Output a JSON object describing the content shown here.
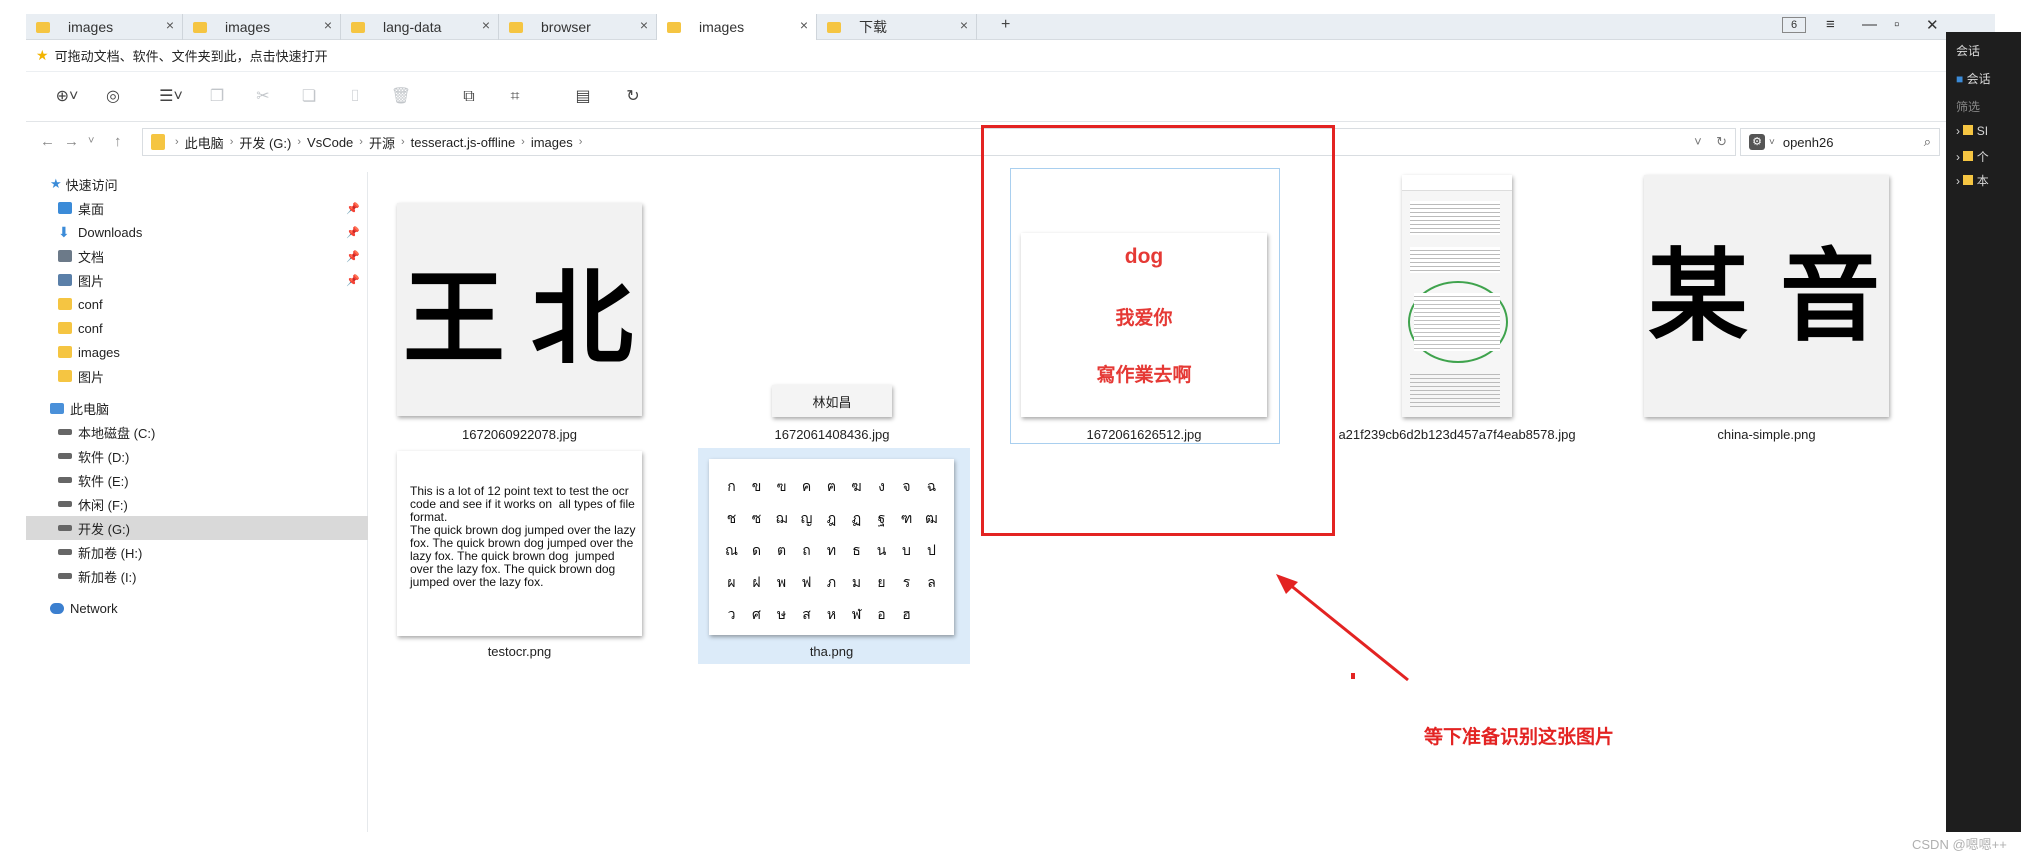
{
  "tabs": [
    {
      "label": "images",
      "active": false
    },
    {
      "label": "images",
      "active": false
    },
    {
      "label": "lang-data",
      "active": false
    },
    {
      "label": "browser",
      "active": false
    },
    {
      "label": "images",
      "active": true
    },
    {
      "label": "下载",
      "active": false
    }
  ],
  "window": {
    "tab_count_badge": "6"
  },
  "quick_hint": "可拖动文档、软件、文件夹到此，点击快速打开",
  "breadcrumb": [
    "此电脑",
    "开发 (G:)",
    "VsCode",
    "开源",
    "tesseract.js-offline",
    "images"
  ],
  "search": {
    "value": "openh26"
  },
  "sidebar": {
    "quick_access": "快速访问",
    "items": [
      "桌面",
      "Downloads",
      "文档",
      "图片",
      "conf",
      "conf",
      "images",
      "图片"
    ],
    "this_pc": "此电脑",
    "drives": [
      "本地磁盘 (C:)",
      "软件 (D:)",
      "软件 (E:)",
      "休闲 (F:)",
      "开发 (G:)",
      "新加卷 (H:)",
      "新加卷 (I:)"
    ],
    "network": "Network"
  },
  "files": {
    "f1": {
      "name": "1672060922078.jpg",
      "chars": [
        "王",
        "北"
      ]
    },
    "f2": {
      "name": "1672061408436.jpg",
      "text": "林如昌"
    },
    "f3": {
      "name": "1672061626512.jpg",
      "lines": [
        "dog",
        "我爱你",
        "寫作業去啊"
      ]
    },
    "f4": {
      "name": "a21f239cb6d2b123d457a7f4eab8578.jpg"
    },
    "f5": {
      "name": "china-simple.png",
      "chars": [
        "某",
        "音"
      ]
    },
    "f6": {
      "name": "testocr.png",
      "text": "This is a lot of 12 point text to test the ocr code and see if it works on  all types of file format.\nThe quick brown dog jumped over the lazy fox. The quick brown dog jumped over the lazy fox. The quick brown dog  jumped over the lazy fox. The quick brown dog jumped over the lazy fox."
    },
    "f7": {
      "name": "tha.png",
      "rows": [
        [
          "ก",
          "ข",
          "ฃ",
          "ค",
          "ฅ",
          "ฆ",
          "ง",
          "จ",
          "ฉ"
        ],
        [
          "ช",
          "ซ",
          "ฌ",
          "ญ",
          "ฎ",
          "ฏ",
          "ฐ",
          "ฑ",
          "ฒ"
        ],
        [
          "ณ",
          "ด",
          "ต",
          "ถ",
          "ท",
          "ธ",
          "น",
          "บ",
          "ป"
        ],
        [
          "ผ",
          "ฝ",
          "พ",
          "ฟ",
          "ภ",
          "ม",
          "ย",
          "ร",
          "ล"
        ],
        [
          "ว",
          "ศ",
          "ษ",
          "ส",
          "ห",
          "ฬ",
          "อ",
          "ฮ"
        ]
      ]
    }
  },
  "annotation": {
    "text": "等下准备识别这张图片",
    "color": "#e32322"
  },
  "dark_panel": {
    "title": "会话",
    "item": "会话",
    "filter": "筛选",
    "rows": [
      "SI",
      "个",
      "本"
    ]
  },
  "watermark": "CSDN @嗯嗯++"
}
